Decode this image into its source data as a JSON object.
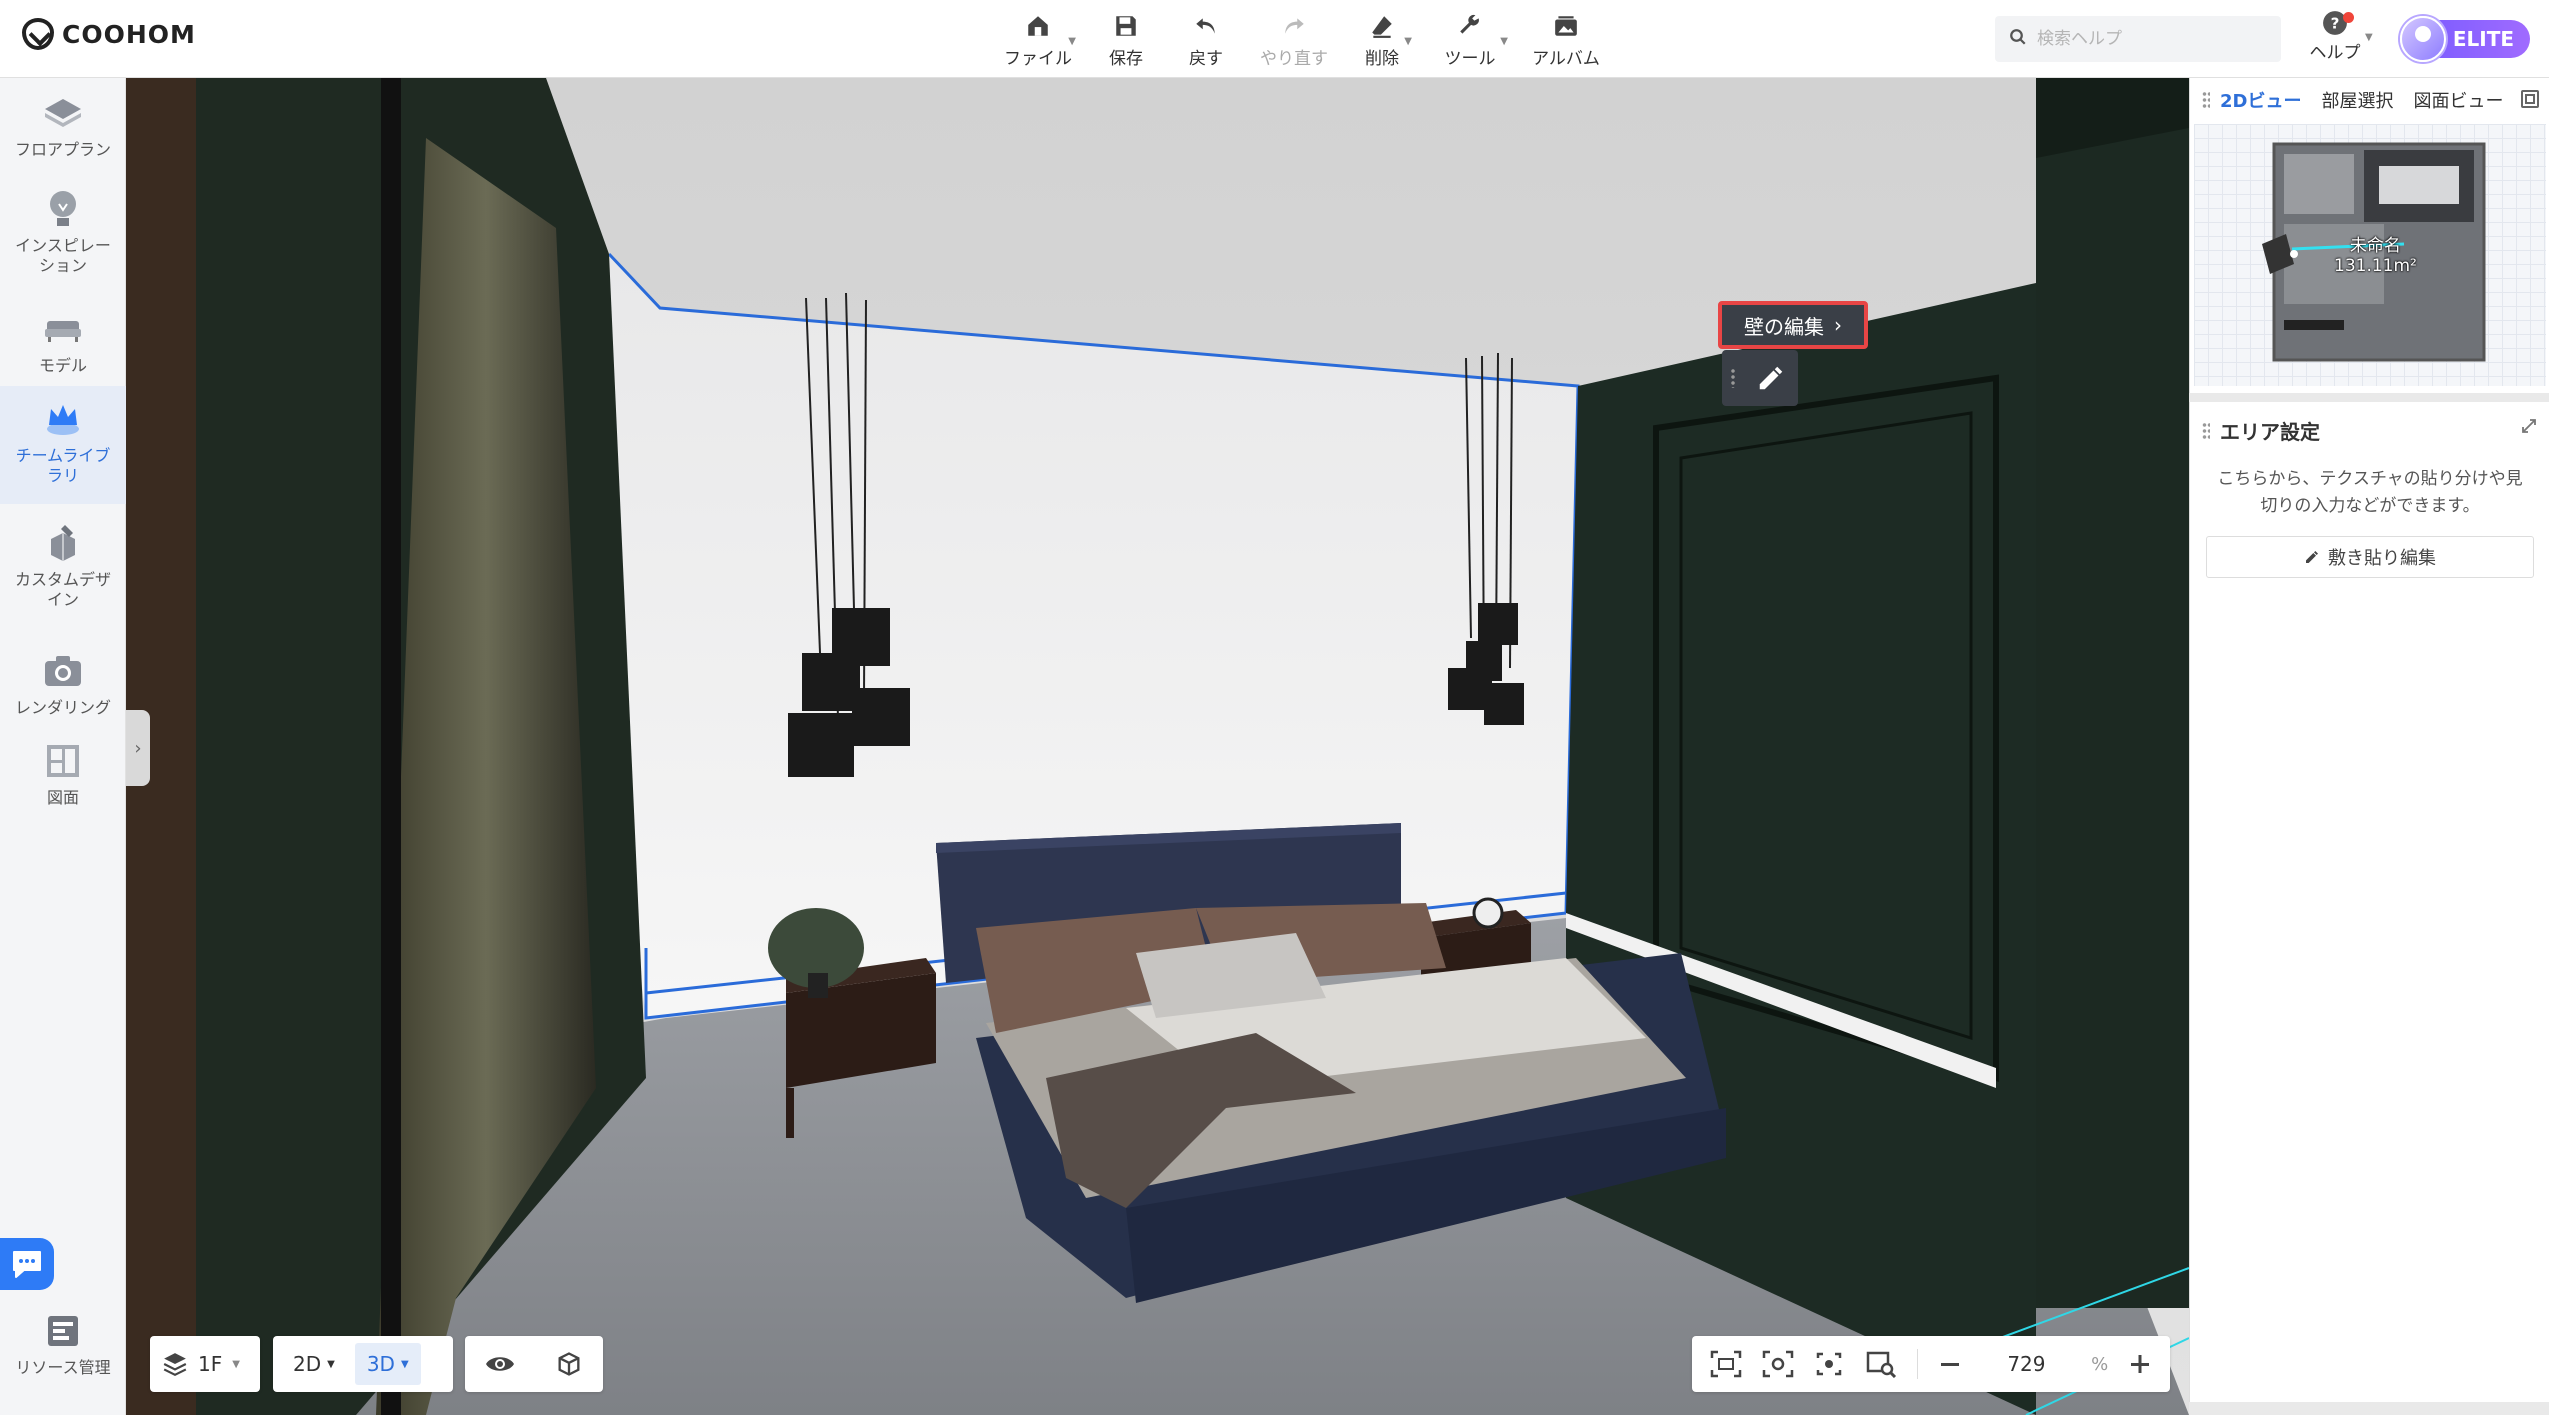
{
  "app": {
    "logo_text": "COOHOM"
  },
  "toolbar": {
    "items": [
      {
        "label": "ファイル",
        "icon": "home-icon",
        "dropdown": true
      },
      {
        "label": "保存",
        "icon": "save-icon",
        "dropdown": false
      },
      {
        "label": "戻す",
        "icon": "undo-icon",
        "dropdown": false
      },
      {
        "label": "やり直す",
        "icon": "redo-icon",
        "dropdown": false,
        "disabled": true
      },
      {
        "label": "削除",
        "icon": "eraser-icon",
        "dropdown": true
      },
      {
        "label": "ツール",
        "icon": "wrench-icon",
        "dropdown": true
      },
      {
        "label": "アルバム",
        "icon": "album-icon",
        "dropdown": false
      }
    ]
  },
  "search": {
    "placeholder": "検索ヘルプ"
  },
  "help": {
    "label": "ヘルプ"
  },
  "account": {
    "badge": "ELITE"
  },
  "sidebar": {
    "items": [
      {
        "label": "フロアプラン",
        "icon": "floorplan-icon"
      },
      {
        "label": "インスピレーション",
        "icon": "lightbulb-icon"
      },
      {
        "label": "モデル",
        "icon": "sofa-icon"
      },
      {
        "label": "チームライブラリ",
        "icon": "crown-icon",
        "active": true
      },
      {
        "label": "カスタムデザイン",
        "icon": "custom-design-icon"
      },
      {
        "label": "レンダリング",
        "icon": "camera-icon"
      },
      {
        "label": "図面",
        "icon": "drawing-icon"
      },
      {
        "label": "リソース管理",
        "icon": "resource-icon"
      }
    ]
  },
  "viewport": {
    "wall_edit_label": "壁の編集",
    "floor": "1F",
    "view_2d": "2D",
    "view_3d": "3D",
    "active_view": "3D",
    "zoom_value": "729",
    "zoom_unit": "%"
  },
  "right_panel": {
    "tabs": [
      {
        "label": "2Dビュー",
        "active": true
      },
      {
        "label": "部屋選択",
        "active": false
      },
      {
        "label": "図面ビュー",
        "active": false
      }
    ],
    "minimap": {
      "room_name": "未命名",
      "room_area": "131.11m²"
    },
    "area_settings": {
      "title": "エリア設定",
      "description": "こちらから、テクスチャの貼り分けや見切りの入力などができます。",
      "button_label": "敷き貼り編集"
    }
  },
  "colors": {
    "accent": "#2e6fd8",
    "highlight_border": "#e84545",
    "elite_gradient_start": "#7b5cff"
  }
}
